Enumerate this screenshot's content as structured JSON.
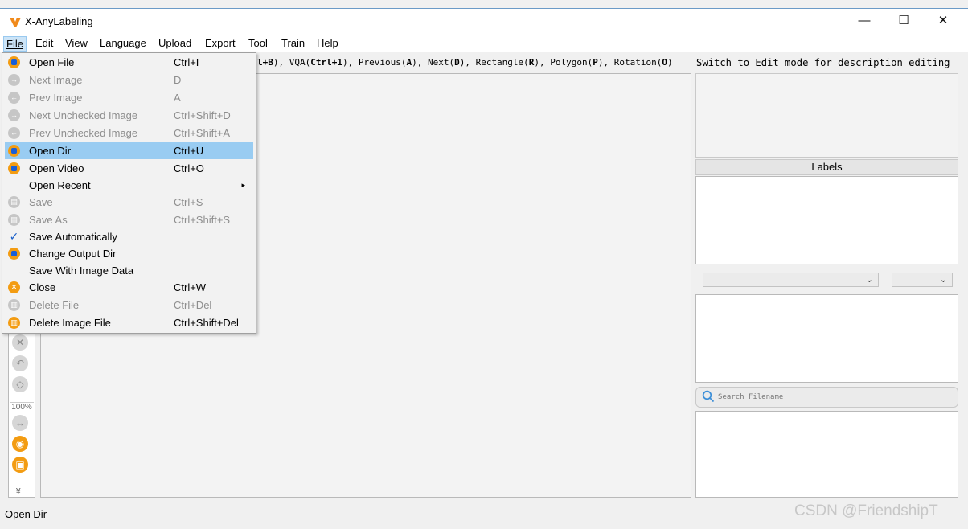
{
  "window": {
    "title": "X-AnyLabeling",
    "minimize_glyph": "—",
    "maximize_glyph": "☐",
    "close_glyph": "✕"
  },
  "menubar": [
    "File",
    "Edit",
    "View",
    "Language",
    "Upload",
    "Export",
    "Tool",
    "Train",
    "Help"
  ],
  "file_menu": {
    "submenu_arrow": "▸",
    "items": [
      {
        "label": "Open File",
        "shortcut": "Ctrl+I",
        "icon": "open-file-icon",
        "enabled": true,
        "highlighted": false
      },
      {
        "label": "Next Image",
        "shortcut": "D",
        "icon": "next-image-icon",
        "enabled": false,
        "highlighted": false
      },
      {
        "label": "Prev Image",
        "shortcut": "A",
        "icon": "prev-image-icon",
        "enabled": false,
        "highlighted": false
      },
      {
        "label": "Next Unchecked Image",
        "shortcut": "Ctrl+Shift+D",
        "icon": "next-unchecked-icon",
        "enabled": false,
        "highlighted": false
      },
      {
        "label": "Prev Unchecked Image",
        "shortcut": "Ctrl+Shift+A",
        "icon": "prev-unchecked-icon",
        "enabled": false,
        "highlighted": false
      },
      {
        "label": "Open Dir",
        "shortcut": "Ctrl+U",
        "icon": "open-dir-icon",
        "enabled": true,
        "highlighted": true
      },
      {
        "label": "Open Video",
        "shortcut": "Ctrl+O",
        "icon": "open-video-icon",
        "enabled": true,
        "highlighted": false
      },
      {
        "label": "Open Recent",
        "shortcut": "",
        "icon": "",
        "enabled": true,
        "highlighted": false,
        "submenu": true
      },
      {
        "label": "Save",
        "shortcut": "Ctrl+S",
        "icon": "save-icon",
        "enabled": false,
        "highlighted": false
      },
      {
        "label": "Save As",
        "shortcut": "Ctrl+Shift+S",
        "icon": "save-as-icon",
        "enabled": false,
        "highlighted": false
      },
      {
        "label": "Save Automatically",
        "shortcut": "",
        "icon": "checkmark-icon",
        "enabled": true,
        "highlighted": false,
        "checked": true
      },
      {
        "label": "Change Output Dir",
        "shortcut": "",
        "icon": "change-output-dir-icon",
        "enabled": true,
        "highlighted": false
      },
      {
        "label": "Save With Image Data",
        "shortcut": "",
        "icon": "",
        "enabled": true,
        "highlighted": false
      },
      {
        "label": "Close",
        "shortcut": "Ctrl+W",
        "icon": "close-icon",
        "enabled": true,
        "highlighted": false
      },
      {
        "label": "Delete File",
        "shortcut": "Ctrl+Del",
        "icon": "delete-file-icon",
        "enabled": false,
        "highlighted": false
      },
      {
        "label": "Delete Image File",
        "shortcut": "Ctrl+Shift+Del",
        "icon": "delete-image-file-icon",
        "enabled": true,
        "highlighted": false
      }
    ]
  },
  "hint_bar": {
    "prefix": "l+B",
    "p1": "), VQA(",
    "k1": "Ctrl+1",
    "p2": "), Previous(",
    "k2": "A",
    "p3": "), Next(",
    "k3": "D",
    "p4": "), Rectangle(",
    "k4": "R",
    "p5": "), Polygon(",
    "k5": "P",
    "p6": "), Rotation(",
    "k6": "O",
    "p7": ")"
  },
  "description_hint": "Switch to Edit mode for description editing",
  "toolbar": {
    "zoom": "100%",
    "more_glyph": "¥"
  },
  "right_panel": {
    "labels_header": "Labels",
    "combo_arrow": "⌄",
    "search_placeholder": "Search Filename"
  },
  "status_bar": {
    "text": "Open Dir"
  },
  "watermark": "CSDN @FriendshipT",
  "colors": {
    "accent": "#f39c12",
    "menu_highlight": "#99ccf2",
    "folder_blue": "#1a5fd8"
  }
}
